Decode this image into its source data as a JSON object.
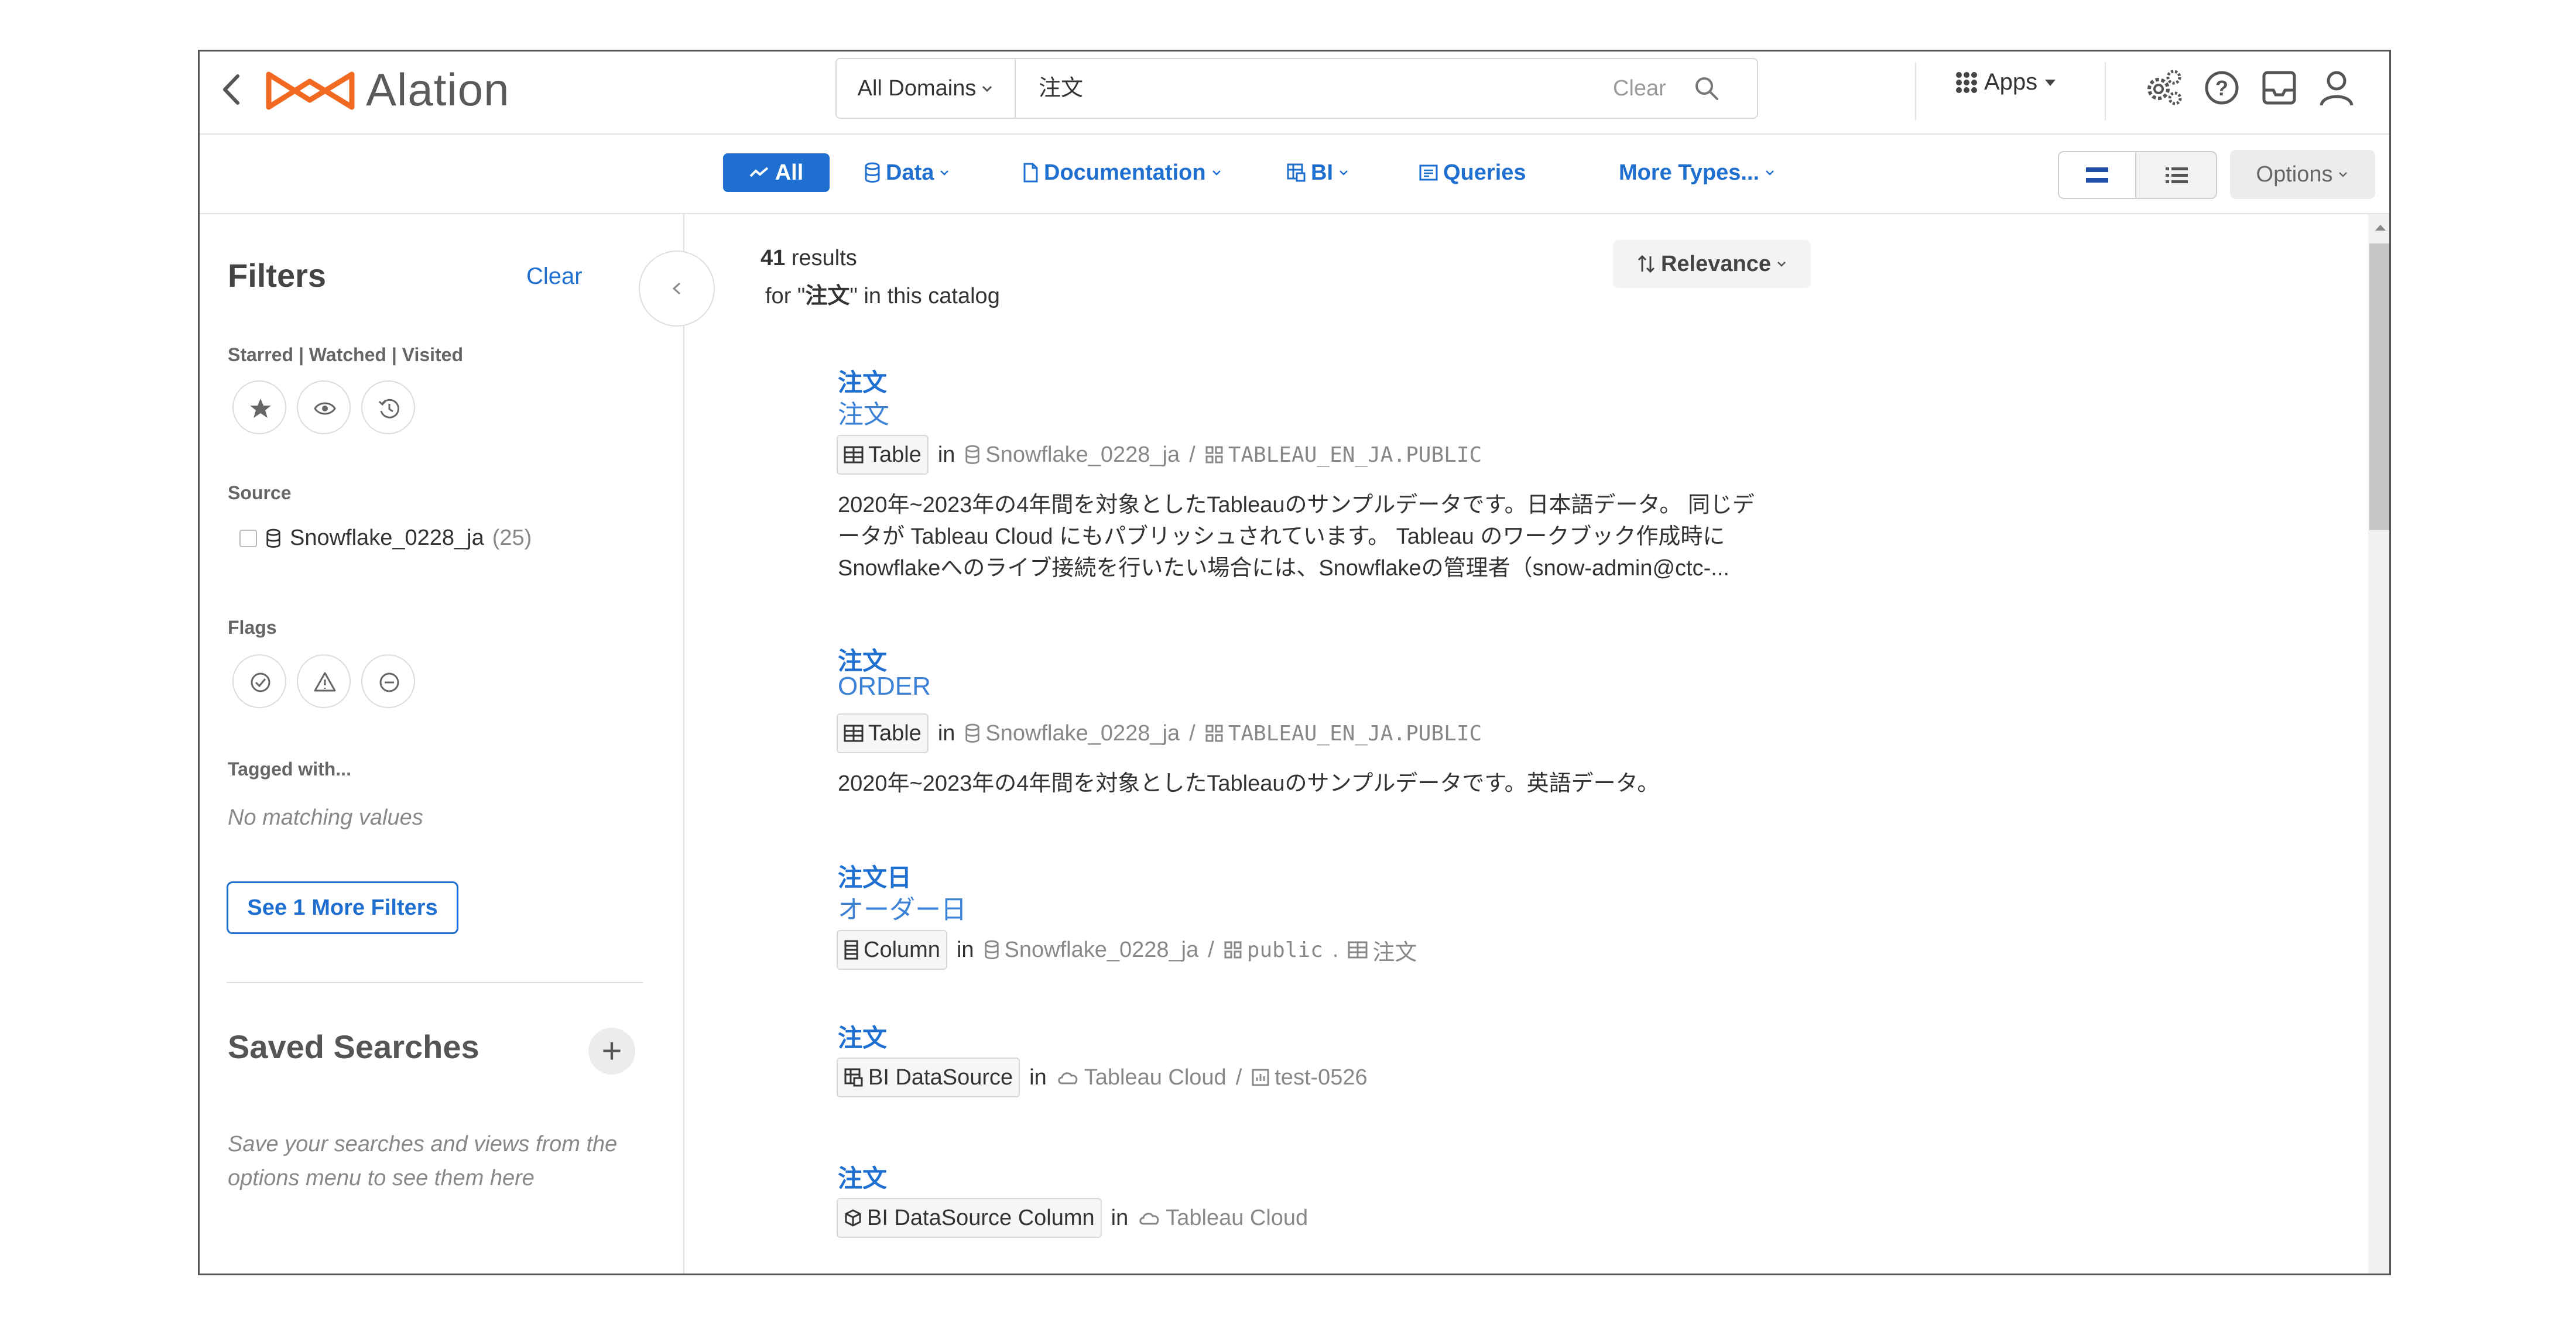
{
  "header": {
    "brand": "Alation",
    "search": {
      "scope": "All Domains",
      "query": "注文",
      "clear_label": "Clear"
    },
    "apps_label": "Apps"
  },
  "typebar": {
    "tabs": [
      {
        "label": "All",
        "active": true
      },
      {
        "label": "Data"
      },
      {
        "label": "Documentation"
      },
      {
        "label": "BI"
      },
      {
        "label": "Queries"
      },
      {
        "label": "More Types..."
      }
    ],
    "options_label": "Options"
  },
  "filters": {
    "title": "Filters",
    "clear_label": "Clear",
    "starred_label": "Starred | Watched | Visited",
    "source_label": "Source",
    "source_item": {
      "name": "Snowflake_0228_ja",
      "count": "(25)"
    },
    "flags_label": "Flags",
    "tagged_label": "Tagged with...",
    "tagged_empty": "No matching values",
    "more_filters_label": "See 1 More Filters"
  },
  "saved_searches": {
    "title": "Saved Searches",
    "description": "Save your searches and views from the options menu to see them here"
  },
  "results": {
    "count": "41",
    "count_suffix": "results",
    "for_prefix": "for \"",
    "query": "注文",
    "for_suffix": "\" in this catalog",
    "sort_label": "Relevance",
    "in_label": "in",
    "items": [
      {
        "title": "注文",
        "subtitle": "注文",
        "type": "Table",
        "source": "Snowflake_0228_ja",
        "schema": "TABLEAU_EN_JA.PUBLIC",
        "desc": [
          "2020年~2023年の4年間を対象としたTableauのサンプルデータです。日本語データ。 同じデ",
          "ータが Tableau Cloud にもパブリッシュされています。 Tableau のワークブック作成時に",
          "Snowflakeへのライブ接続を行いたい場合には、Snowflakeの管理者（snow-admin@ctc-..."
        ]
      },
      {
        "title": "注文",
        "subtitle": "ORDER",
        "type": "Table",
        "source": "Snowflake_0228_ja",
        "schema": "TABLEAU_EN_JA.PUBLIC",
        "desc": [
          "2020年~2023年の4年間を対象としたTableauのサンプルデータです。英語データ。"
        ]
      },
      {
        "title": "注文日",
        "subtitle": "オーダー日",
        "type": "Column",
        "source": "Snowflake_0228_ja",
        "schema": "public",
        "table": "注文"
      },
      {
        "title": "注文",
        "type": "BI DataSource",
        "source": "Tableau Cloud",
        "folder": "test-0526"
      },
      {
        "title": "注文",
        "type": "BI DataSource Column",
        "source": "Tableau Cloud"
      }
    ]
  }
}
